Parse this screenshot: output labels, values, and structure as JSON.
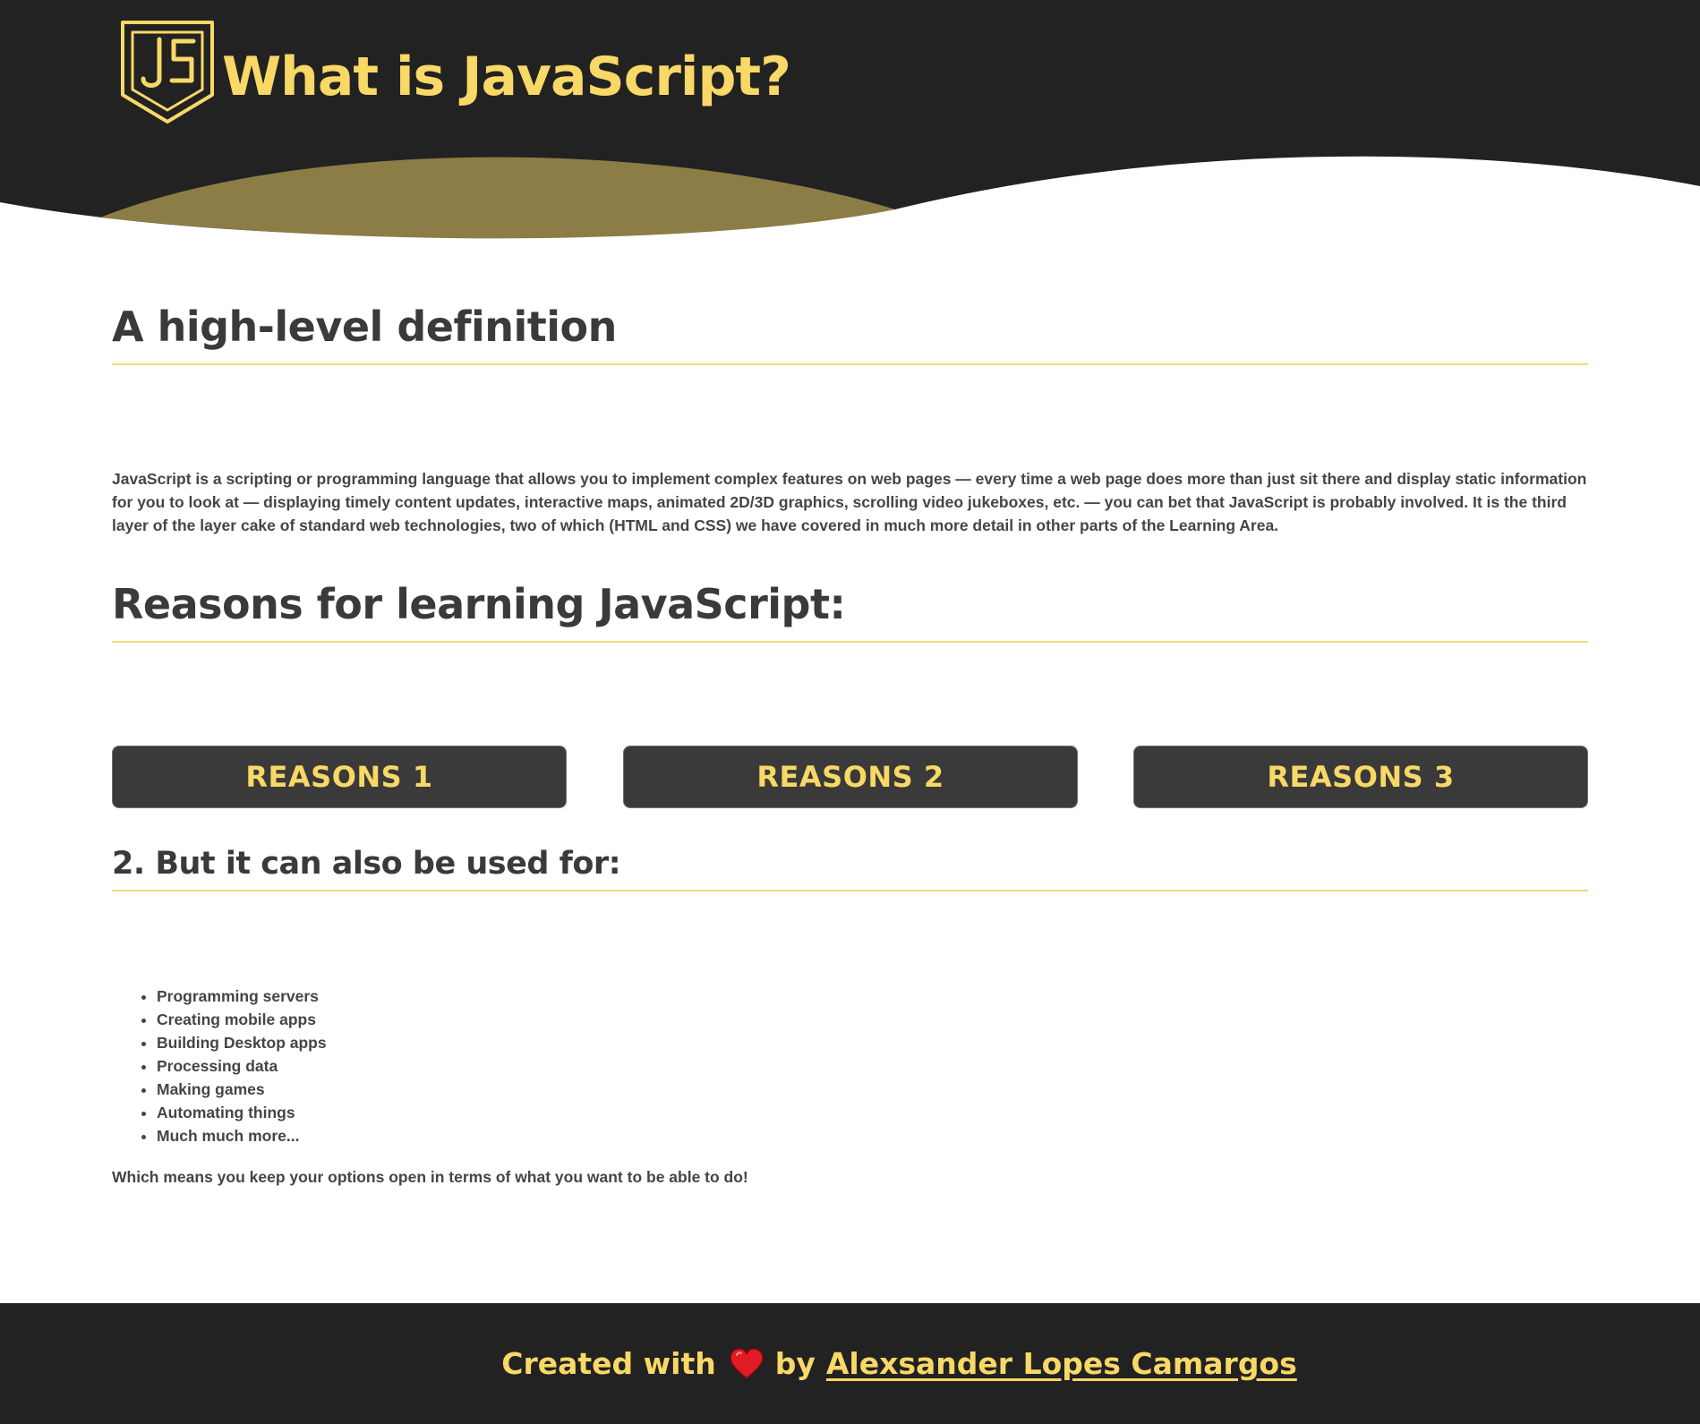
{
  "header": {
    "title": "What is JavaScript?",
    "logo_icon": "js-shield-icon",
    "colors": {
      "background": "#222222",
      "accent": "#f8d866",
      "wave": "#8c7d47"
    }
  },
  "sections": {
    "definition": {
      "heading": "A high-level definition",
      "body": "JavaScript is a scripting or programming language that allows you to implement complex features on web pages — every time a web page does more than just sit there and display static information for you to look at — displaying timely content updates, interactive maps, animated 2D/3D graphics, scrolling video jukeboxes, etc. — you can bet that JavaScript is probably involved. It is the third layer of the layer cake of standard web technologies, two of which (HTML and CSS) we have covered in much more detail in other parts of the Learning Area."
    },
    "reasons": {
      "heading": "Reasons for learning JavaScript:",
      "buttons": [
        "REASONS 1",
        "REASONS 2",
        "REASONS 3"
      ]
    },
    "also_used": {
      "heading": "2. But it can also be used for:",
      "items": [
        "Programming servers",
        "Creating mobile apps",
        "Building Desktop apps",
        "Processing data",
        "Making games",
        "Automating things",
        "Much much more..."
      ],
      "closing": "Which means you keep your options open in terms of what you want to be able to do!"
    }
  },
  "footer": {
    "prefix": "Created with",
    "heart_icon": "heart-icon",
    "by": "by",
    "author": "Alexsander Lopes Camargos"
  }
}
